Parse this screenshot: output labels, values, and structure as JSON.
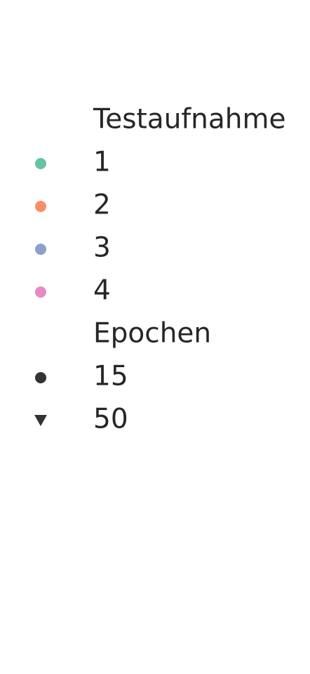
{
  "chart_data": {
    "type": "legend",
    "legend": {
      "groups": [
        {
          "title": "Testaufnahme",
          "encoding": "color",
          "entries": [
            {
              "label": "1",
              "color": "#66c2a5",
              "marker": "circle"
            },
            {
              "label": "2",
              "color": "#fc8d62",
              "marker": "circle"
            },
            {
              "label": "3",
              "color": "#8da0cb",
              "marker": "circle"
            },
            {
              "label": "4",
              "color": "#e78ac3",
              "marker": "circle"
            }
          ]
        },
        {
          "title": "Epochen",
          "encoding": "marker",
          "entries": [
            {
              "label": "15",
              "color": "#333333",
              "marker": "circle"
            },
            {
              "label": "50",
              "color": "#333333",
              "marker": "triangle-down"
            }
          ]
        }
      ]
    }
  }
}
